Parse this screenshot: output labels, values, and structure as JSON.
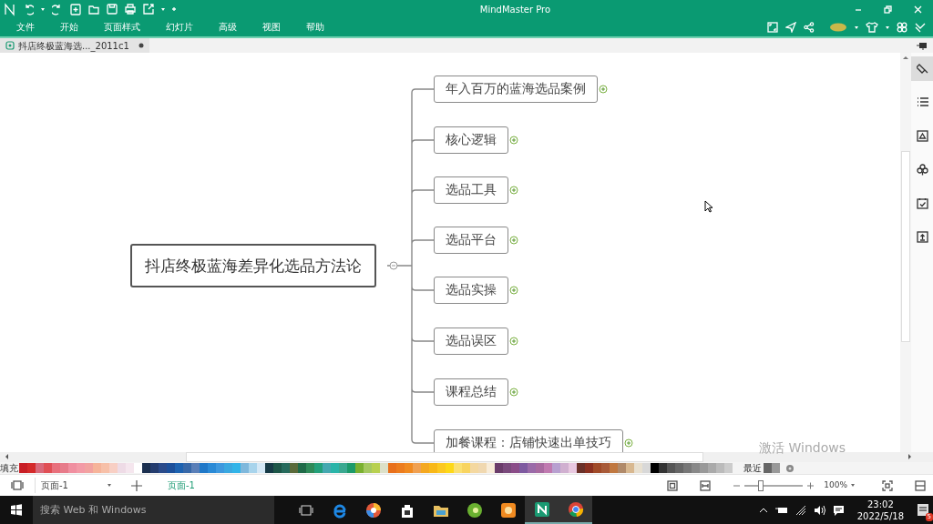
{
  "window": {
    "title": "MindMaster Pro"
  },
  "menu": [
    "文件",
    "开始",
    "页面样式",
    "幻灯片",
    "高级",
    "视图",
    "帮助"
  ],
  "document_tab": {
    "label": "抖店终极蓝海选..._2011c1"
  },
  "mind_map": {
    "central": "抖店终极蓝海差异化选品方法论",
    "branches": [
      {
        "label": "年入百万的蓝海选品案例",
        "expanded": false
      },
      {
        "label": "核心逻辑",
        "expanded": false
      },
      {
        "label": "选品工具",
        "expanded": false
      },
      {
        "label": "选品平台",
        "expanded": false
      },
      {
        "label": "选品实操",
        "expanded": false
      },
      {
        "label": "选品误区",
        "expanded": false
      },
      {
        "label": "课程总结",
        "expanded": false
      },
      {
        "label": "加餐课程：店铺快速出单技巧",
        "expanded": false
      }
    ]
  },
  "side_panel": [
    {
      "selected": true
    },
    {
      "selected": false
    },
    {
      "selected": false
    },
    {
      "selected": false
    },
    {
      "selected": false
    },
    {
      "selected": false
    }
  ],
  "palette": {
    "label": "填充",
    "swatches": [
      {
        "color": "#c81e25"
      },
      {
        "color": "#d42a2a"
      },
      {
        "color": "#d9687a"
      },
      {
        "color": "#e04f55"
      },
      {
        "color": "#e8707c"
      },
      {
        "color": "#e77b8a"
      },
      {
        "color": "#f08fa0"
      },
      {
        "color": "#f39aa6"
      },
      {
        "color": "#f2a2a0"
      },
      {
        "color": "#f6b49a"
      },
      {
        "color": "#f7c0a8"
      },
      {
        "color": "#f8cfc4"
      },
      {
        "color": "#eedbe6"
      },
      {
        "color": "#f5e6ee"
      },
      {
        "color": "#ffffff"
      },
      {
        "color": "#1b2f4f"
      },
      {
        "color": "#243c6e"
      },
      {
        "color": "#2a4a8a"
      },
      {
        "color": "#1c4f9a"
      },
      {
        "color": "#1d62b0"
      },
      {
        "color": "#3768a8"
      },
      {
        "color": "#5a7fb8"
      },
      {
        "color": "#1f78c8"
      },
      {
        "color": "#2a8ad6"
      },
      {
        "color": "#3d98de"
      },
      {
        "color": "#3aa8e0"
      },
      {
        "color": "#32b4e8"
      },
      {
        "color": "#7fb8dc"
      },
      {
        "color": "#a8d4ec"
      },
      {
        "color": "#d4e8f6"
      },
      {
        "color": "#163a46"
      },
      {
        "color": "#1d5648"
      },
      {
        "color": "#266a5c"
      },
      {
        "color": "#5a6a3a"
      },
      {
        "color": "#1f6a48"
      },
      {
        "color": "#2e8a58"
      },
      {
        "color": "#23a07a"
      },
      {
        "color": "#45a8b0"
      },
      {
        "color": "#2ab4a8"
      },
      {
        "color": "#3aa890"
      },
      {
        "color": "#1c9a6a"
      },
      {
        "color": "#7ab030"
      },
      {
        "color": "#a4c860"
      },
      {
        "color": "#b8d050"
      },
      {
        "color": "#dce0c8"
      },
      {
        "color": "#e8701c"
      },
      {
        "color": "#ec7c1e"
      },
      {
        "color": "#f08a20"
      },
      {
        "color": "#f0a050"
      },
      {
        "color": "#f4a820"
      },
      {
        "color": "#f8b818"
      },
      {
        "color": "#fcc820"
      },
      {
        "color": "#fdd818"
      },
      {
        "color": "#fbe070"
      },
      {
        "color": "#f8d460"
      },
      {
        "color": "#f4d8a0"
      },
      {
        "color": "#f0d8b0"
      },
      {
        "color": "#f8ecd8"
      },
      {
        "color": "#6a3c6a"
      },
      {
        "color": "#7a4a7c"
      },
      {
        "color": "#8a4c88"
      },
      {
        "color": "#7e5aa0"
      },
      {
        "color": "#9a6aa8"
      },
      {
        "color": "#a86aa0"
      },
      {
        "color": "#c07ab0"
      },
      {
        "color": "#b8a0d0"
      },
      {
        "color": "#d0b0d0"
      },
      {
        "color": "#e8c8e0"
      },
      {
        "color": "#6a3028"
      },
      {
        "color": "#8a3020"
      },
      {
        "color": "#a04a28"
      },
      {
        "color": "#a85a38"
      },
      {
        "color": "#c07840"
      },
      {
        "color": "#b08a6a"
      },
      {
        "color": "#d8b890"
      },
      {
        "color": "#e8e0d0"
      },
      {
        "color": "#d8d8d8"
      },
      {
        "color": "#000000"
      },
      {
        "color": "#333333"
      },
      {
        "color": "#555555"
      },
      {
        "color": "#666666"
      },
      {
        "color": "#777777"
      },
      {
        "color": "#888888"
      },
      {
        "color": "#999999"
      },
      {
        "color": "#aaaaaa"
      },
      {
        "color": "#bbbbbb"
      },
      {
        "color": "#cccccc"
      }
    ],
    "recent_label": "最近",
    "recent": [
      {
        "color": "#666666"
      },
      {
        "color": "#999999"
      }
    ]
  },
  "status_bar": {
    "page_select": "页面-1",
    "pages": [
      {
        "label": "页面-1",
        "selected": true
      }
    ],
    "zoom": {
      "level": 0.25,
      "reading": "100%"
    }
  },
  "activation_notice": "激活 Windows",
  "taskbar": {
    "search_placeholder": "搜索 Web 和 Windows",
    "time": "23:02",
    "date": "2022/5/18",
    "notifications": "5"
  }
}
